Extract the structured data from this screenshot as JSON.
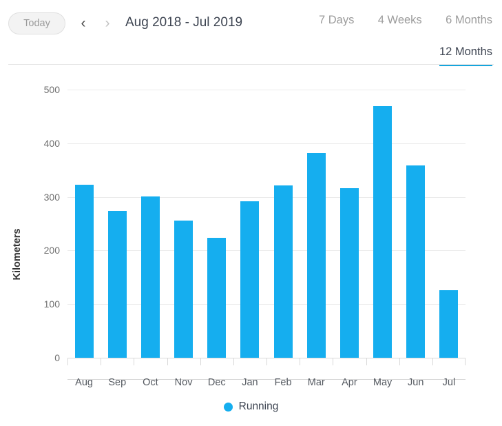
{
  "toolbar": {
    "today_label": "Today",
    "prev_icon": "‹",
    "next_icon": "›",
    "range_title": "Aug 2018 - Jul 2019",
    "tabs": [
      {
        "label": "7 Days",
        "active": false
      },
      {
        "label": "4 Weeks",
        "active": false
      },
      {
        "label": "6 Months",
        "active": false
      },
      {
        "label": "12 Months",
        "active": true
      }
    ]
  },
  "colors": {
    "bar": "#15aeef",
    "accent": "#16a5dd",
    "gridline": "#ebebeb",
    "axis": "#d8d8d8",
    "tab_inactive": "#9b9b9b",
    "tab_active": "#3d4451"
  },
  "chart_data": {
    "type": "bar",
    "title": "",
    "xlabel": "",
    "ylabel": "Kilometers",
    "ylim": [
      0,
      500
    ],
    "yticks": [
      0,
      100,
      200,
      300,
      400,
      500
    ],
    "grid": true,
    "legend_position": "bottom",
    "categories": [
      "Aug",
      "Sep",
      "Oct",
      "Nov",
      "Dec",
      "Jan",
      "Feb",
      "Mar",
      "Apr",
      "May",
      "Jun",
      "Jul"
    ],
    "series": [
      {
        "name": "Running",
        "color": "#15aeef",
        "values": [
          323,
          274,
          301,
          256,
          224,
          292,
          321,
          382,
          316,
          469,
          358,
          126
        ]
      }
    ]
  }
}
